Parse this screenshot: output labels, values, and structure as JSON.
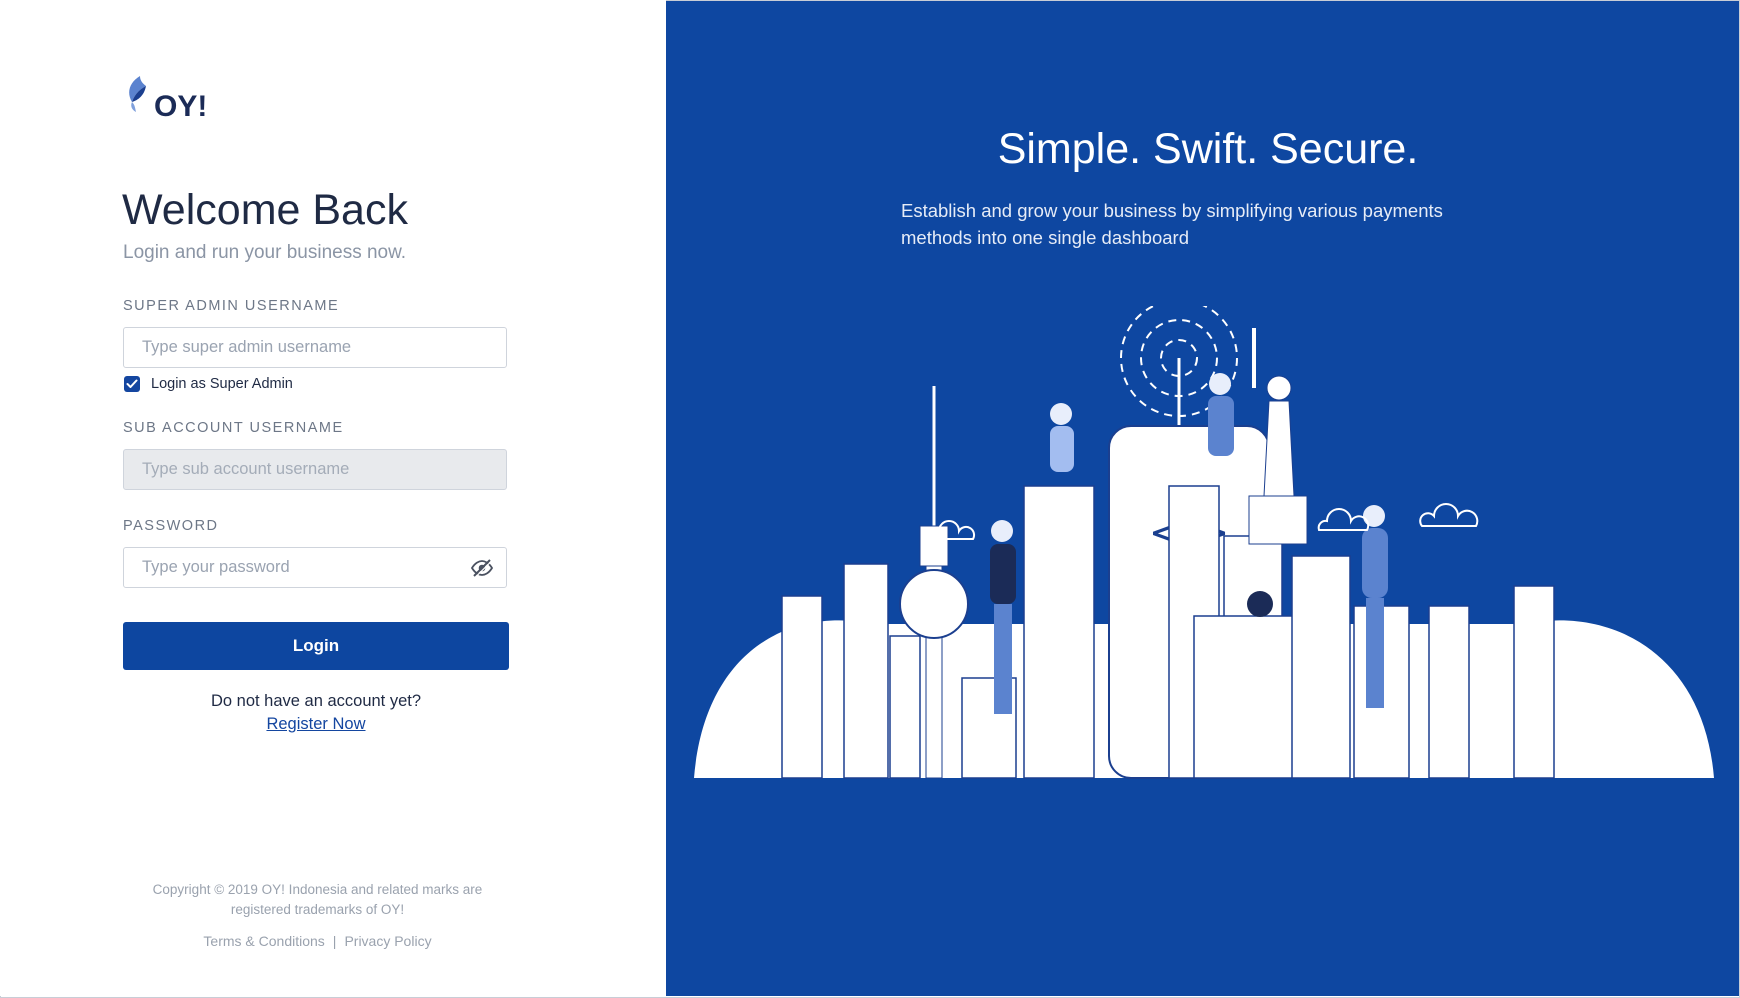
{
  "brand": {
    "logo_text": "OY!",
    "primary_color": "#0e47a1",
    "button_color": "#0d46a0"
  },
  "login": {
    "title": "Welcome Back",
    "subtitle": "Login and run your business now.",
    "super_admin": {
      "label": "SUPER ADMIN USERNAME",
      "placeholder": "Type super admin username",
      "value": ""
    },
    "super_admin_checkbox": {
      "label": "Login as Super Admin",
      "checked": true
    },
    "sub_account": {
      "label": "SUB ACCOUNT USERNAME",
      "placeholder": "Type sub account username",
      "disabled": true
    },
    "password": {
      "label": "PASSWORD",
      "placeholder": "Type your password",
      "toggle_icon": "eye-slash-icon"
    },
    "login_button": "Login",
    "no_account_text": "Do not have an account yet?",
    "register_link": "Register Now"
  },
  "footer": {
    "copyright_line1": "Copyright © 2019 OY! Indonesia and related marks are",
    "copyright_line2": "registered trademarks of OY!",
    "terms": "Terms & Conditions",
    "separator": "|",
    "privacy": "Privacy Policy"
  },
  "promo": {
    "headline": "Simple. Swift. Secure.",
    "description_line1": "Establish and grow your business by simplifying various payments",
    "description_line2": "methods into one single dashboard",
    "illustration": "city-skyline-illustration"
  }
}
